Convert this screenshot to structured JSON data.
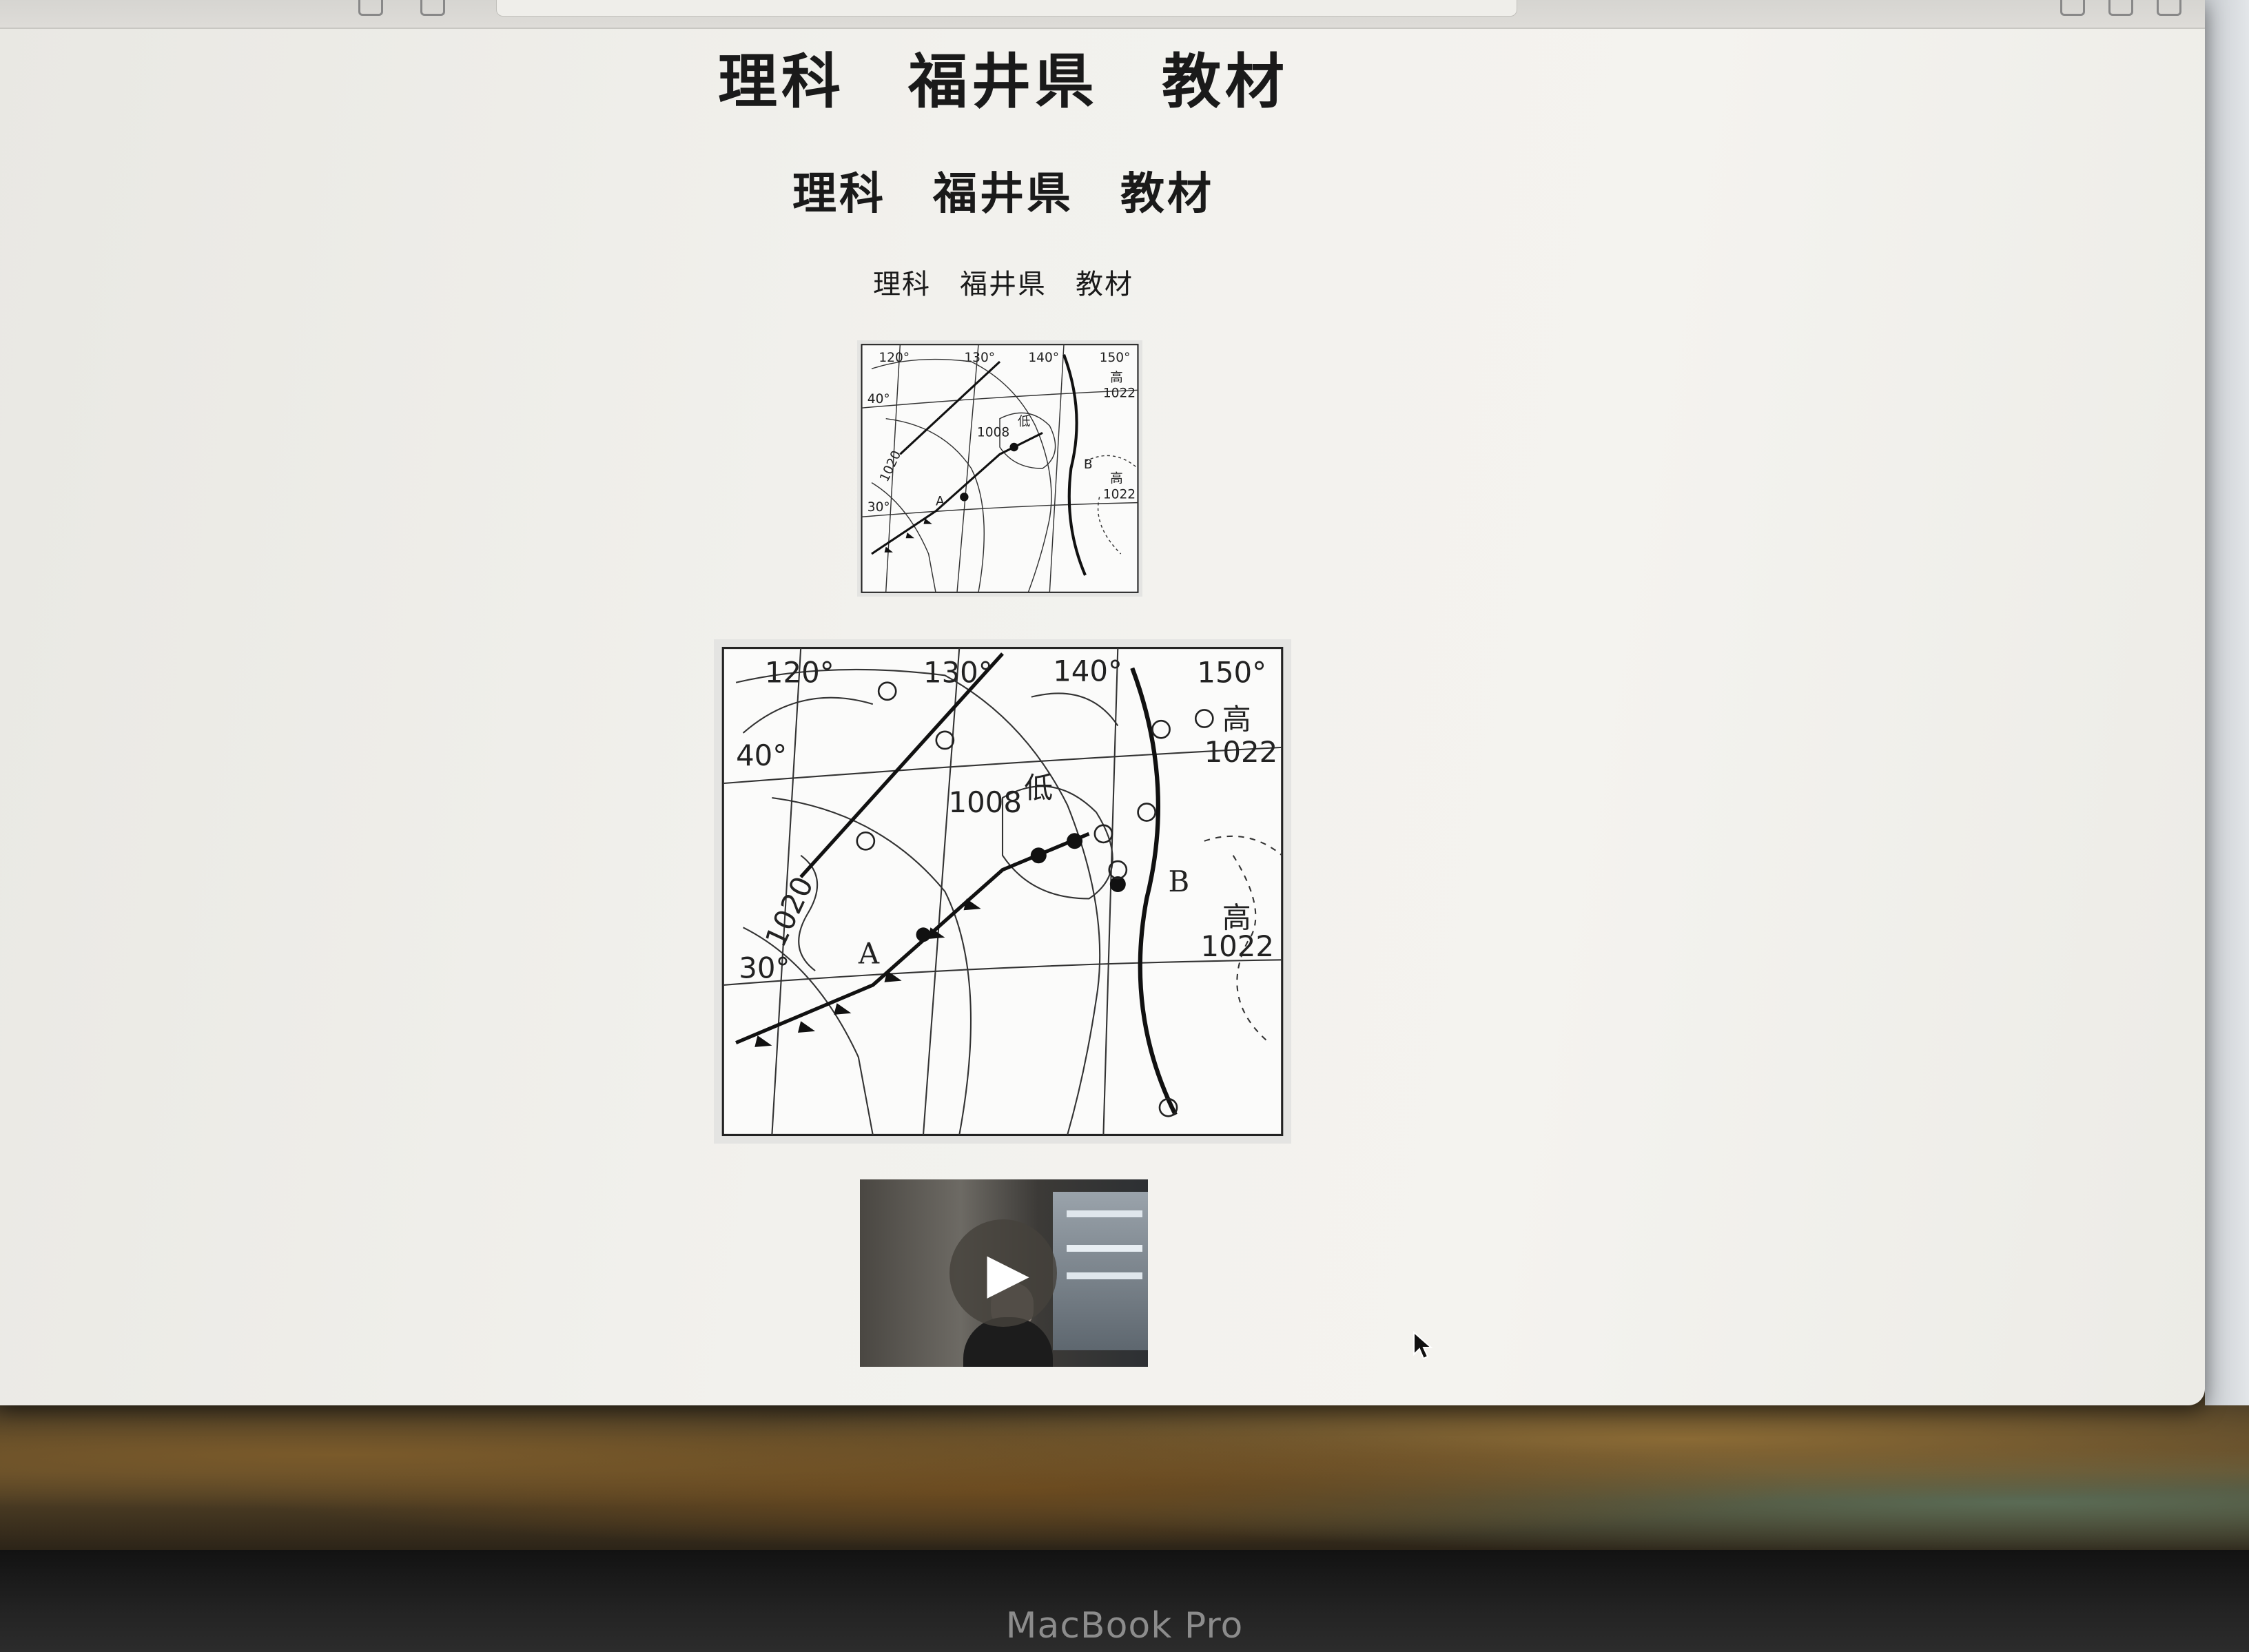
{
  "page": {
    "heading_large": "理科　福井県　教材",
    "heading_medium": "理科　福井県　教材",
    "heading_small": "理科　福井県　教材"
  },
  "weather_map": {
    "longitudes": [
      "120°",
      "130°",
      "140°",
      "150°"
    ],
    "latitudes": [
      "40°",
      "30°"
    ],
    "isobars": [
      "1008",
      "1020",
      "1022",
      "1022"
    ],
    "low_label": "低",
    "high_label": "高",
    "point_a": "A",
    "point_b": "B"
  },
  "video": {
    "play_icon": "play-icon"
  },
  "device": {
    "bezel_label": "MacBook Pro"
  }
}
